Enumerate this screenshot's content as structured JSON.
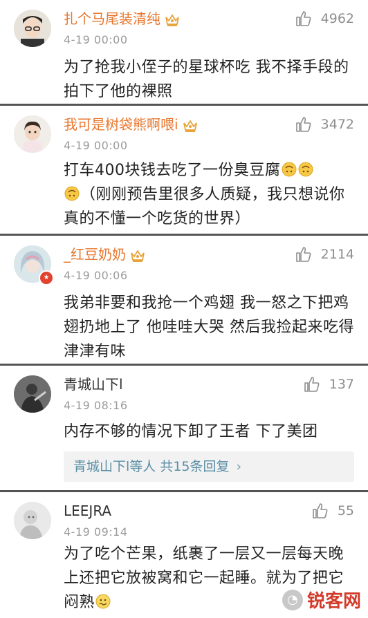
{
  "comments": [
    {
      "username": "扎个马尾装清纯",
      "time": "4-19 00:00",
      "likes": "4962",
      "text": "为了抢我小侄子的星球杯吃 我不择手段的拍下了他的裸照",
      "name_color": "#e8772e"
    },
    {
      "username": "我可是树袋熊啊喂i",
      "time": "4-19 00:00",
      "likes": "3472",
      "text_a": "打车400块钱去吃了一份臭豆腐",
      "text_b": "（刚刚预告里很多人质疑，我只想说你真的不懂一个吃货的世界）",
      "name_color": "#e8772e"
    },
    {
      "username": "_红豆奶奶",
      "time": "4-19 00:06",
      "likes": "2114",
      "text": "我弟非要和我抢一个鸡翅 我一怒之下把鸡翅扔地上了 他哇哇大哭 然后我捡起来吃得津津有味",
      "name_color": "#e8772e"
    },
    {
      "username": "青城山下l",
      "time": "4-19 08:16",
      "likes": "137",
      "text": "内存不够的情况下卸了王者 下了美团",
      "reply_summary": "青城山下l等人",
      "reply_count": "共15条回复",
      "reply_chevron": "›"
    },
    {
      "username": "LEEJRA",
      "time": "4-19 09:14",
      "likes": "55",
      "text": "为了吃个芒果，纸裹了一层又一层每天晚上还把它放被窝和它一起睡。就为了把它闷熟"
    }
  ],
  "icons": {
    "like": "thumbs-up-icon",
    "crown": "crown-badge-icon",
    "emoji_upside": "upside-down-face-icon",
    "emoji_sweat": "nervous-face-icon"
  },
  "watermark": {
    "text": "锐客网"
  }
}
